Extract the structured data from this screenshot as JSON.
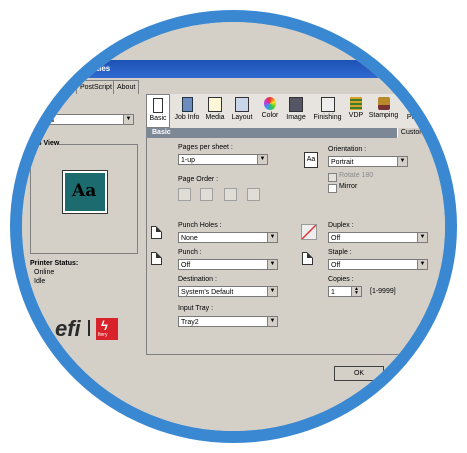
{
  "window": {
    "title": "perties"
  },
  "tabs": [
    {
      "label": "PostScript"
    },
    {
      "label": "About"
    }
  ],
  "left": {
    "job_select_value": "ntitled",
    "job_view_label": "ob View",
    "preview_text": "Aa",
    "printer_status_label": "Printer Status:",
    "status_lines": [
      "Online",
      "Idle"
    ],
    "logo_text": "efi",
    "fiery_text": "fiery"
  },
  "toolbar": [
    {
      "label": "Basic",
      "icon": "basic-icon"
    },
    {
      "label": "Job Info",
      "icon": "job-info-icon"
    },
    {
      "label": "Media",
      "icon": "media-icon"
    },
    {
      "label": "Layout",
      "icon": "layout-icon"
    },
    {
      "label": "Color",
      "icon": "color-icon"
    },
    {
      "label": "Image",
      "icon": "image-icon"
    },
    {
      "label": "Finishing",
      "icon": "finishing-icon"
    },
    {
      "label": "VDP",
      "icon": "vdp-icon"
    },
    {
      "label": "Stamping",
      "icon": "stamping-icon"
    },
    {
      "label": "Printe",
      "icon": "printer-icon"
    }
  ],
  "section": {
    "title": "Basic",
    "customize": "Customize"
  },
  "basic": {
    "pages_per_sheet_label": "Pages per sheet :",
    "pages_per_sheet_value": "1-up",
    "page_order_label": "Page Order :",
    "orientation_label": "Orientation :",
    "orientation_value": "Portrait",
    "rotate_label": "Rotate 180",
    "mirror_label": "Mirror",
    "punch_holes_label": "Punch Holes :",
    "punch_holes_value": "None",
    "punch_label": "Punch :",
    "punch_value": "Off",
    "destination_label": "Destination :",
    "destination_value": "System's Default",
    "input_tray_label": "Input Tray :",
    "input_tray_value": "Tray2",
    "duplex_label": "Duplex :",
    "duplex_value": "Off",
    "staple_label": "Staple :",
    "staple_value": "Off",
    "copies_label": "Copies :",
    "copies_value": "1",
    "copies_range": "[1-9999]"
  },
  "footer": {
    "ok_label": "OK"
  }
}
